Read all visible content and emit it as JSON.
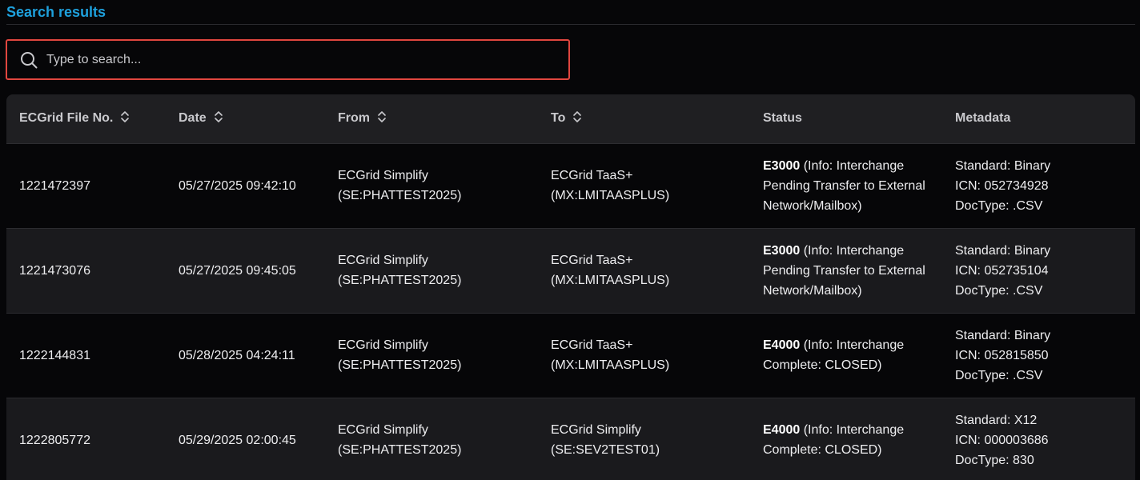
{
  "section_title": "Search results",
  "search": {
    "placeholder": "Type to search...",
    "value": ""
  },
  "accent_color": "#1ea0dc",
  "focus_border_color": "#e0463f",
  "table": {
    "columns": [
      {
        "label": "ECGrid File No.",
        "sortable": true
      },
      {
        "label": "Date",
        "sortable": true
      },
      {
        "label": "From",
        "sortable": true
      },
      {
        "label": "To",
        "sortable": true
      },
      {
        "label": "Status",
        "sortable": false
      },
      {
        "label": "Metadata",
        "sortable": false
      }
    ],
    "rows": [
      {
        "file_no": "1221472397",
        "date": "05/27/2025 09:42:10",
        "from": [
          "ECGrid Simplify",
          "(SE:PHATTEST2025)"
        ],
        "to": [
          "ECGrid TaaS+",
          "(MX:LMITAASPLUS)"
        ],
        "status_code": "E3000",
        "status_text": " (Info: Interchange Pending Transfer to External Network/Mailbox)",
        "metadata": [
          "Standard: Binary",
          "ICN: 052734928",
          "DocType: .CSV"
        ]
      },
      {
        "file_no": "1221473076",
        "date": "05/27/2025 09:45:05",
        "from": [
          "ECGrid Simplify",
          "(SE:PHATTEST2025)"
        ],
        "to": [
          "ECGrid TaaS+",
          "(MX:LMITAASPLUS)"
        ],
        "status_code": "E3000",
        "status_text": " (Info: Interchange Pending Transfer to External Network/Mailbox)",
        "metadata": [
          "Standard: Binary",
          "ICN: 052735104",
          "DocType: .CSV"
        ]
      },
      {
        "file_no": "1222144831",
        "date": "05/28/2025 04:24:11",
        "from": [
          "ECGrid Simplify",
          "(SE:PHATTEST2025)"
        ],
        "to": [
          "ECGrid TaaS+",
          "(MX:LMITAASPLUS)"
        ],
        "status_code": "E4000",
        "status_text": " (Info: Interchange Complete: CLOSED)",
        "metadata": [
          "Standard: Binary",
          "ICN: 052815850",
          "DocType: .CSV"
        ]
      },
      {
        "file_no": "1222805772",
        "date": "05/29/2025 02:00:45",
        "from": [
          "ECGrid Simplify",
          "(SE:PHATTEST2025)"
        ],
        "to": [
          "ECGrid Simplify",
          "(SE:SEV2TEST01)"
        ],
        "status_code": "E4000",
        "status_text": " (Info: Interchange Complete: CLOSED)",
        "metadata": [
          "Standard: X12",
          "ICN: 000003686",
          "DocType: 830"
        ]
      }
    ]
  }
}
